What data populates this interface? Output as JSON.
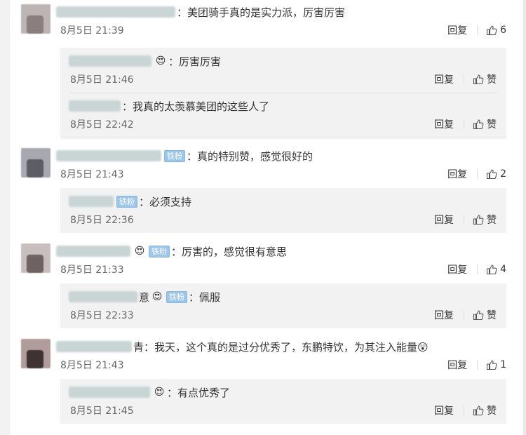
{
  "comments": [
    {
      "text": "：美团骑手真的是实力派，厉害厉害",
      "time": "8月5日 21:39",
      "reply_label": "回复",
      "likes": "6",
      "replies": [
        {
          "text": "：厉害厉害",
          "time": "8月5日 21:46",
          "reply_label": "回复",
          "like_label": "赞"
        },
        {
          "text": "：我真的太羡慕美团的这些人了",
          "time": "8月5日 22:42",
          "reply_label": "回复",
          "like_label": "赞"
        }
      ]
    },
    {
      "badge": "铁粉",
      "text": "：真的特别赞，感觉很好的",
      "time": "8月5日 21:43",
      "reply_label": "回复",
      "likes": "2",
      "replies": [
        {
          "badge": "铁粉",
          "text": "：必须支持",
          "time": "8月5日 22:36",
          "reply_label": "回复",
          "like_label": "赞"
        }
      ]
    },
    {
      "badge": "铁粉",
      "text": "：厉害的，感觉很有意思",
      "time": "8月5日 21:33",
      "reply_label": "回复",
      "likes": "4",
      "replies": [
        {
          "name_suffix": "意",
          "badge": "铁粉",
          "text": "：佩服",
          "time": "8月5日 22:33",
          "reply_label": "回复",
          "like_label": "赞"
        }
      ]
    },
    {
      "name_suffix": "青",
      "text": "：我天，这个真的是过分优秀了，东鹏特饮，为其注入能量😲",
      "time": "8月5日 21:43",
      "reply_label": "回复",
      "likes": "1",
      "replies": [
        {
          "text": "：有点优秀了",
          "time": "8月5日 21:45",
          "reply_label": "回复",
          "like_label": "赞"
        }
      ]
    }
  ],
  "icons": {
    "thumb": "thumbs-up-icon",
    "emoji": "heart-eyes-emoji-icon"
  },
  "colors": {
    "reply_bg": "#f2f2f2",
    "badge_bg": "#9ec6e8",
    "meta_text": "#666666"
  }
}
